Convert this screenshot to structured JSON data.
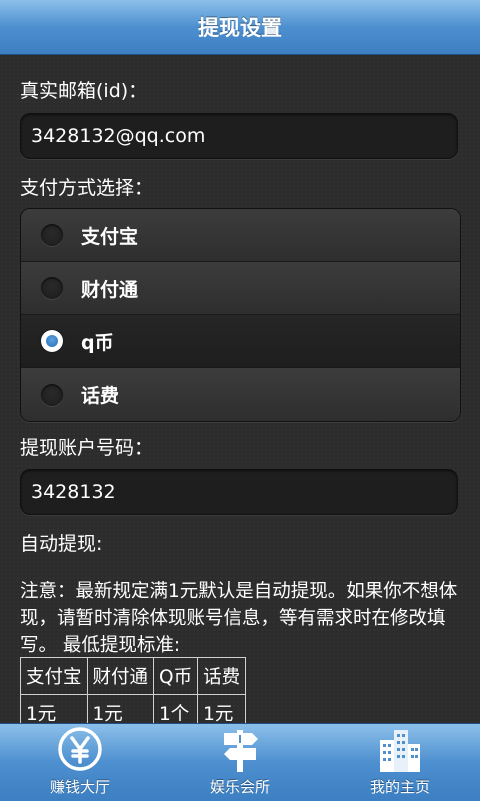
{
  "header": {
    "title": "提现设置"
  },
  "email": {
    "label": "真实邮箱(id)：",
    "value": "3428132@qq.com"
  },
  "payment": {
    "label": "支付方式选择：",
    "options": [
      {
        "label": "支付宝",
        "selected": false
      },
      {
        "label": "财付通",
        "selected": false
      },
      {
        "label": "q币",
        "selected": true
      },
      {
        "label": "话费",
        "selected": false
      }
    ]
  },
  "account": {
    "label": "提现账户号码：",
    "value": "3428132"
  },
  "auto_withdraw": {
    "label": "自动提现:"
  },
  "notice": {
    "text": "注意：最新规定满1元默认是自动提现。如果你不想体现，请暂时清除体现账号信息，等有需求时在修改填写。 最低提现标准:"
  },
  "standards": {
    "headers": [
      "支付宝",
      "财付通",
      "Q币",
      "话费"
    ],
    "values": [
      "1元",
      "1元",
      "1个",
      "1元"
    ]
  },
  "tabs": [
    {
      "label": "赚钱大厅",
      "icon": "yen-coin-icon"
    },
    {
      "label": "娱乐会所",
      "icon": "signpost-icon"
    },
    {
      "label": "我的主页",
      "icon": "buildings-icon"
    }
  ],
  "colors": {
    "accent": "#4d8fcf",
    "background": "#2c2c2c",
    "radio_selected": "#2a6fb6"
  }
}
